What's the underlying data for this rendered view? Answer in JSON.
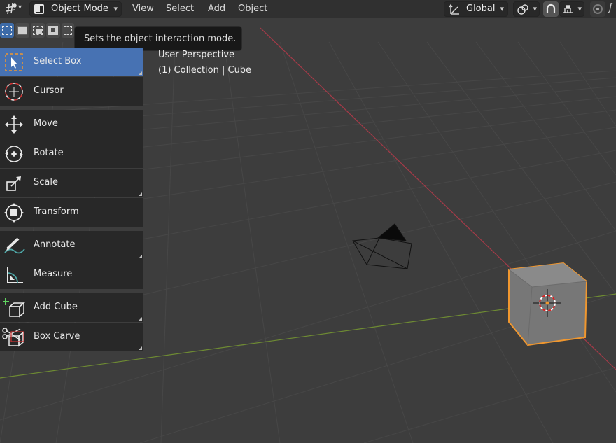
{
  "header": {
    "mode_label": "Object Mode",
    "menus": [
      "View",
      "Select",
      "Add",
      "Object"
    ],
    "orientation_label": "Global",
    "editor_type_icon": "editor-type-icon",
    "cursor_icon": "proportional-edit-icon"
  },
  "tooltip": {
    "text": "Sets the object interaction mode."
  },
  "tools": [
    {
      "label": "Select Box",
      "icon": "select-box-icon",
      "active": true
    },
    {
      "label": "Cursor",
      "icon": "cursor-icon"
    },
    {
      "label": "Move",
      "icon": "move-icon"
    },
    {
      "label": "Rotate",
      "icon": "rotate-icon"
    },
    {
      "label": "Scale",
      "icon": "scale-icon"
    },
    {
      "label": "Transform",
      "icon": "transform-icon"
    },
    {
      "label": "Annotate",
      "icon": "annotate-icon"
    },
    {
      "label": "Measure",
      "icon": "measure-icon"
    },
    {
      "label": "Add Cube",
      "icon": "add-cube-icon"
    },
    {
      "label": "Box Carve",
      "icon": "box-carve-icon"
    }
  ],
  "viewport": {
    "perspective": "User Perspective",
    "collection": "(1) Collection | Cube"
  },
  "colors": {
    "active_tool": "#4772b3",
    "selection_outline": "#f0972f",
    "x_axis": "#a63a48",
    "y_axis": "#6e8b33"
  }
}
